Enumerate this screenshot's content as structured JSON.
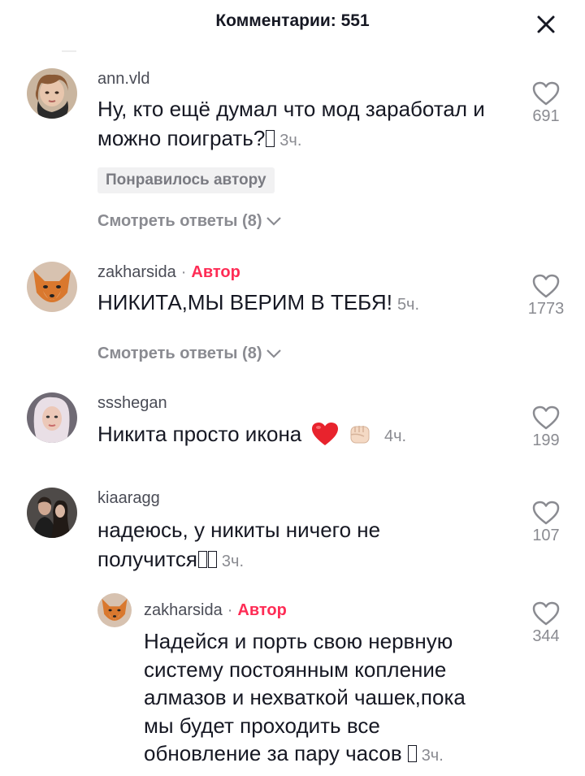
{
  "header": {
    "title": "Комментарии: 551"
  },
  "comments": [
    {
      "username": "ann.vld",
      "text": "Ну, кто ещё думал что мод заработал и можно поиграть?",
      "time": "3ч.",
      "badge": "Понравилось автору",
      "replies": "Смотреть ответы (8)",
      "likes": "691"
    },
    {
      "username": "zakharsida",
      "author_label": "Автор",
      "text": "НИКИТА,МЫ ВЕРИМ В ТЕБЯ!",
      "time": "5ч.",
      "replies": "Смотреть ответы (8)",
      "likes": "1773"
    },
    {
      "username": "ssshegan",
      "text": "Никита просто икона",
      "time": "4ч.",
      "likes": "199"
    },
    {
      "username": "kiaaragg",
      "text_line1": "надеюсь, у никиты ничего не",
      "text_line2": "получится",
      "time": "3ч.",
      "likes": "107"
    },
    {
      "username": "zakharsida",
      "author_label": "Автор",
      "lines": [
        "Надейся и порть свою нервную",
        "систему постоянным копление",
        "алмазов и нехваткой чашек,пока",
        "мы будет проходить все",
        "обновление за пару часов"
      ],
      "time": "3ч.",
      "likes": "344"
    }
  ],
  "colors": {
    "author": "#fe2c55",
    "muted": "#8a8b91",
    "text": "#161823"
  },
  "icons": {
    "close": "close-icon",
    "like": "heart-outline-icon",
    "chevron": "chevron-down-icon"
  }
}
